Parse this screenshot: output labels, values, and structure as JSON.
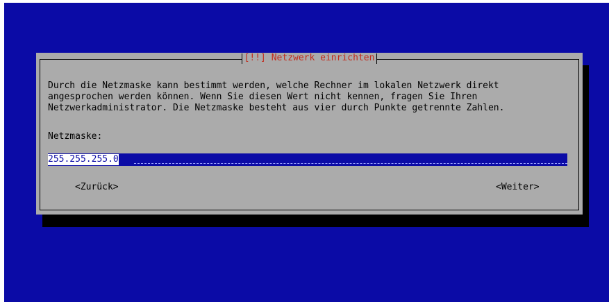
{
  "dialog": {
    "title": "[!!] Netzwerk einrichten",
    "description": "Durch die Netzmaske kann bestimmt werden, welche Rechner im lokalen Netzwerk direkt\nangesprochen werden können. Wenn Sie diesen Wert nicht kennen, fragen Sie Ihren\nNetzwerkadministrator. Die Netzmaske besteht aus vier durch Punkte getrennte Zahlen.",
    "field_label": "Netzmaske:",
    "field_value": "255.255.255.0",
    "back_label": "<Zurück>",
    "next_label": "<Weiter>"
  },
  "colors": {
    "background": "#0b0ba6",
    "dialog": "#ababab",
    "title": "#c22b1c",
    "shadow": "#000000"
  }
}
